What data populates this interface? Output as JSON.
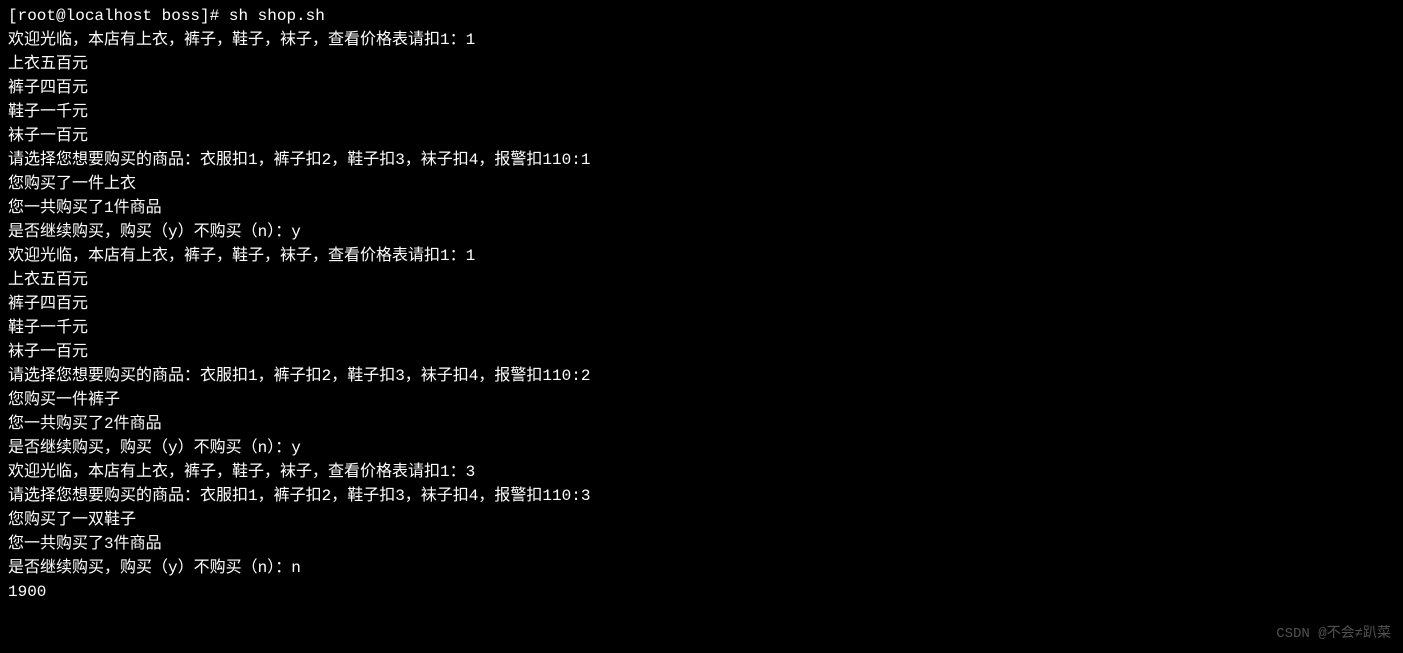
{
  "prompt": "[root@localhost boss]# ",
  "command": "sh shop.sh",
  "lines": [
    "欢迎光临，本店有上衣，裤子，鞋子，袜子，查看价格表请扣1：1",
    "上衣五百元",
    "裤子四百元",
    "鞋子一千元",
    "袜子一百元",
    "请选择您想要购买的商品：衣服扣1，裤子扣2，鞋子扣3，袜子扣4，报警扣110:1",
    "您购买了一件上衣",
    "您一共购买了1件商品",
    "是否继续购买，购买（y）不购买（n）：y",
    "欢迎光临，本店有上衣，裤子，鞋子，袜子，查看价格表请扣1：1",
    "上衣五百元",
    "裤子四百元",
    "鞋子一千元",
    "袜子一百元",
    "请选择您想要购买的商品：衣服扣1，裤子扣2，鞋子扣3，袜子扣4，报警扣110:2",
    "您购买一件裤子",
    "您一共购买了2件商品",
    "是否继续购买，购买（y）不购买（n）：y",
    "欢迎光临，本店有上衣，裤子，鞋子，袜子，查看价格表请扣1：3",
    "请选择您想要购买的商品：衣服扣1，裤子扣2，鞋子扣3，袜子扣4，报警扣110:3",
    "您购买了一双鞋子",
    "您一共购买了3件商品",
    "是否继续购买，购买（y）不购买（n）：n",
    "1900"
  ],
  "watermark": "CSDN @不会≠趴菜"
}
